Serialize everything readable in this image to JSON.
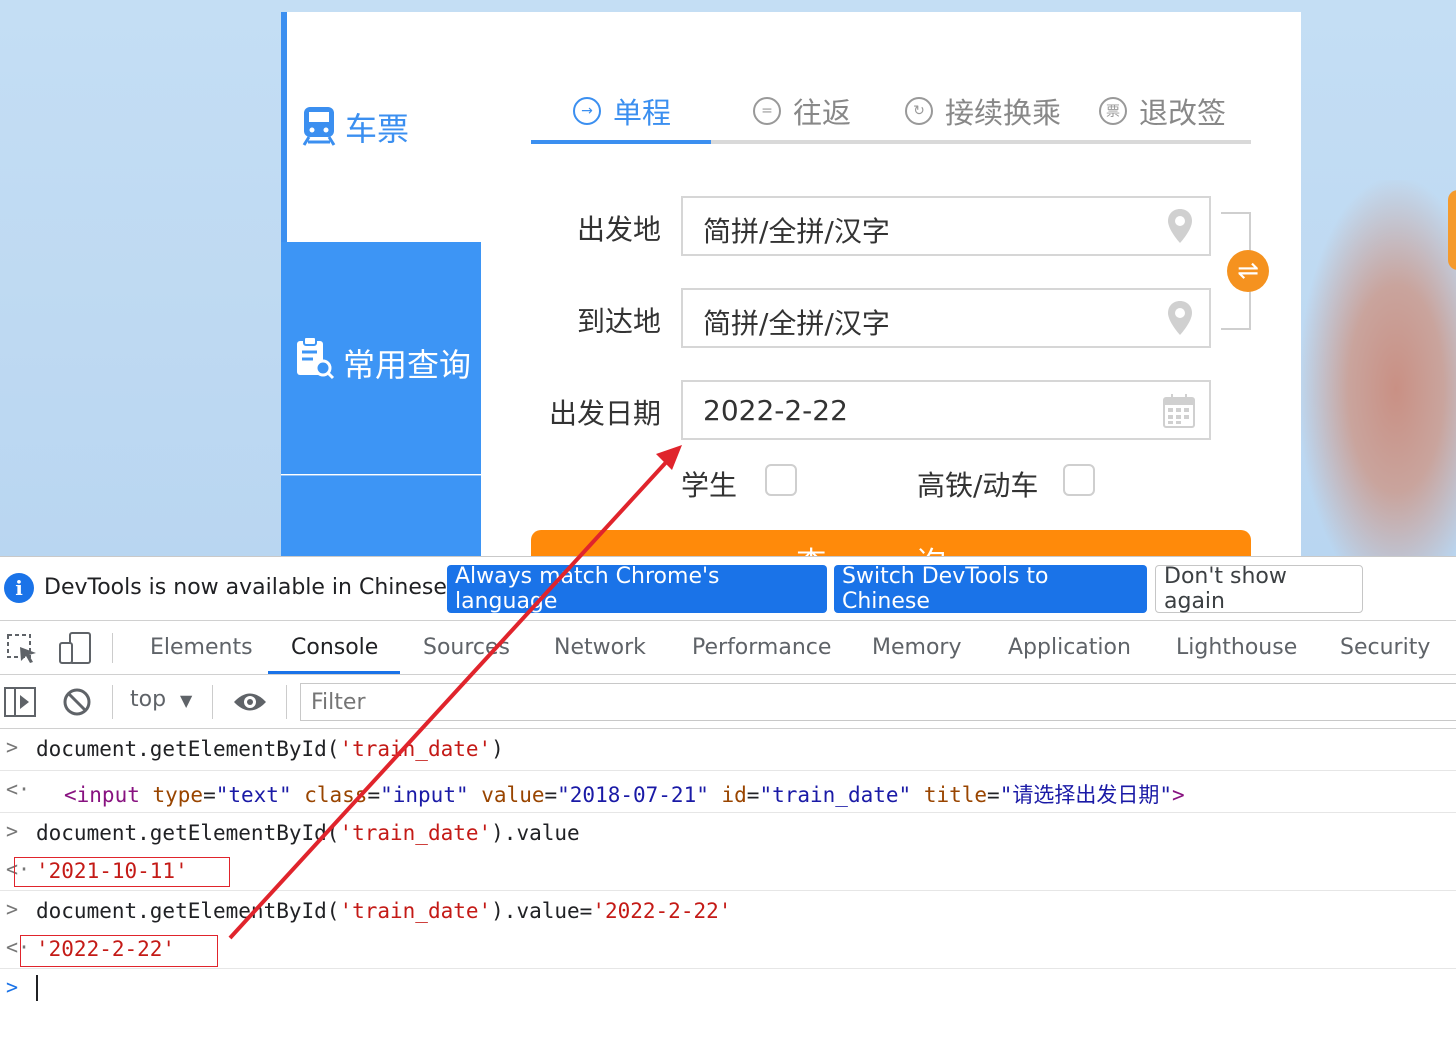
{
  "page": {
    "side_tabs": [
      "车票",
      "常用查询"
    ],
    "trip_tabs": [
      "单程",
      "往返",
      "接续换乘",
      "退改签"
    ],
    "active_trip_tab": "单程",
    "tab_icons": [
      "arrow-circle-icon",
      "equals-circle-icon",
      "refresh-circle-icon",
      "ticket-circle-icon"
    ],
    "from_label": "出发地",
    "from_value": "简拼/全拼/汉字",
    "to_label": "到达地",
    "to_value": "简拼/全拼/汉字",
    "date_label": "出发日期",
    "date_value": "2022-2-22",
    "student_label": "学生",
    "highspeed_label": "高铁/动车",
    "search_label": "查 询",
    "accent_color": "#3b8ff0",
    "button_color": "#ff8a0a"
  },
  "devtools": {
    "infobar": {
      "message": "DevTools is now available in Chinese!",
      "always_match": "Always match Chrome's language",
      "switch": "Switch DevTools to Chinese",
      "dont_show": "Don't show again"
    },
    "tabs": [
      "Elements",
      "Console",
      "Sources",
      "Network",
      "Performance",
      "Memory",
      "Application",
      "Lighthouse",
      "Security"
    ],
    "active_tab": "Console",
    "context": "top",
    "filter_placeholder": "Filter",
    "console": {
      "cmd1_a": "document.getElementById(",
      "cmd1_arg": "'train_date'",
      "cmd1_b": ")",
      "out1_open": "<input",
      "out1_type_attr": " type",
      "out1_type_val": "\"text\"",
      "out1_class_attr": " class",
      "out1_class_val": "\"input\"",
      "out1_value_attr": " value",
      "out1_value_val": "\"2018-07-21\"",
      "out1_id_attr": " id",
      "out1_id_val": "\"train_date\"",
      "out1_title_attr": " title",
      "out1_title_val": "\"请选择出发日期\"",
      "out1_close": ">",
      "eq": "=",
      "cmd2_a": "document.getElementById(",
      "cmd2_arg": "'train_date'",
      "cmd2_b": ").value",
      "out2": "'2021-10-11'",
      "cmd3_a": "document.getElementById(",
      "cmd3_arg": "'train_date'",
      "cmd3_b": ").value=",
      "cmd3_val": "'2022-2-22'",
      "out3": "'2022-2-22'"
    },
    "accent_color": "#1a73e8"
  }
}
